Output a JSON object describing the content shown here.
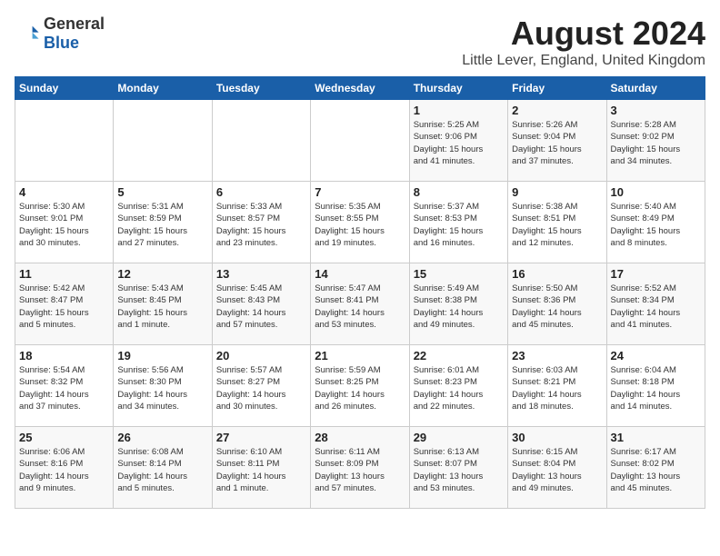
{
  "header": {
    "logo_general": "General",
    "logo_blue": "Blue",
    "month_year": "August 2024",
    "location": "Little Lever, England, United Kingdom"
  },
  "days_of_week": [
    "Sunday",
    "Monday",
    "Tuesday",
    "Wednesday",
    "Thursday",
    "Friday",
    "Saturday"
  ],
  "weeks": [
    [
      {
        "day": "",
        "detail": ""
      },
      {
        "day": "",
        "detail": ""
      },
      {
        "day": "",
        "detail": ""
      },
      {
        "day": "",
        "detail": ""
      },
      {
        "day": "1",
        "detail": "Sunrise: 5:25 AM\nSunset: 9:06 PM\nDaylight: 15 hours\nand 41 minutes."
      },
      {
        "day": "2",
        "detail": "Sunrise: 5:26 AM\nSunset: 9:04 PM\nDaylight: 15 hours\nand 37 minutes."
      },
      {
        "day": "3",
        "detail": "Sunrise: 5:28 AM\nSunset: 9:02 PM\nDaylight: 15 hours\nand 34 minutes."
      }
    ],
    [
      {
        "day": "4",
        "detail": "Sunrise: 5:30 AM\nSunset: 9:01 PM\nDaylight: 15 hours\nand 30 minutes."
      },
      {
        "day": "5",
        "detail": "Sunrise: 5:31 AM\nSunset: 8:59 PM\nDaylight: 15 hours\nand 27 minutes."
      },
      {
        "day": "6",
        "detail": "Sunrise: 5:33 AM\nSunset: 8:57 PM\nDaylight: 15 hours\nand 23 minutes."
      },
      {
        "day": "7",
        "detail": "Sunrise: 5:35 AM\nSunset: 8:55 PM\nDaylight: 15 hours\nand 19 minutes."
      },
      {
        "day": "8",
        "detail": "Sunrise: 5:37 AM\nSunset: 8:53 PM\nDaylight: 15 hours\nand 16 minutes."
      },
      {
        "day": "9",
        "detail": "Sunrise: 5:38 AM\nSunset: 8:51 PM\nDaylight: 15 hours\nand 12 minutes."
      },
      {
        "day": "10",
        "detail": "Sunrise: 5:40 AM\nSunset: 8:49 PM\nDaylight: 15 hours\nand 8 minutes."
      }
    ],
    [
      {
        "day": "11",
        "detail": "Sunrise: 5:42 AM\nSunset: 8:47 PM\nDaylight: 15 hours\nand 5 minutes."
      },
      {
        "day": "12",
        "detail": "Sunrise: 5:43 AM\nSunset: 8:45 PM\nDaylight: 15 hours\nand 1 minute."
      },
      {
        "day": "13",
        "detail": "Sunrise: 5:45 AM\nSunset: 8:43 PM\nDaylight: 14 hours\nand 57 minutes."
      },
      {
        "day": "14",
        "detail": "Sunrise: 5:47 AM\nSunset: 8:41 PM\nDaylight: 14 hours\nand 53 minutes."
      },
      {
        "day": "15",
        "detail": "Sunrise: 5:49 AM\nSunset: 8:38 PM\nDaylight: 14 hours\nand 49 minutes."
      },
      {
        "day": "16",
        "detail": "Sunrise: 5:50 AM\nSunset: 8:36 PM\nDaylight: 14 hours\nand 45 minutes."
      },
      {
        "day": "17",
        "detail": "Sunrise: 5:52 AM\nSunset: 8:34 PM\nDaylight: 14 hours\nand 41 minutes."
      }
    ],
    [
      {
        "day": "18",
        "detail": "Sunrise: 5:54 AM\nSunset: 8:32 PM\nDaylight: 14 hours\nand 37 minutes."
      },
      {
        "day": "19",
        "detail": "Sunrise: 5:56 AM\nSunset: 8:30 PM\nDaylight: 14 hours\nand 34 minutes."
      },
      {
        "day": "20",
        "detail": "Sunrise: 5:57 AM\nSunset: 8:27 PM\nDaylight: 14 hours\nand 30 minutes."
      },
      {
        "day": "21",
        "detail": "Sunrise: 5:59 AM\nSunset: 8:25 PM\nDaylight: 14 hours\nand 26 minutes."
      },
      {
        "day": "22",
        "detail": "Sunrise: 6:01 AM\nSunset: 8:23 PM\nDaylight: 14 hours\nand 22 minutes."
      },
      {
        "day": "23",
        "detail": "Sunrise: 6:03 AM\nSunset: 8:21 PM\nDaylight: 14 hours\nand 18 minutes."
      },
      {
        "day": "24",
        "detail": "Sunrise: 6:04 AM\nSunset: 8:18 PM\nDaylight: 14 hours\nand 14 minutes."
      }
    ],
    [
      {
        "day": "25",
        "detail": "Sunrise: 6:06 AM\nSunset: 8:16 PM\nDaylight: 14 hours\nand 9 minutes."
      },
      {
        "day": "26",
        "detail": "Sunrise: 6:08 AM\nSunset: 8:14 PM\nDaylight: 14 hours\nand 5 minutes."
      },
      {
        "day": "27",
        "detail": "Sunrise: 6:10 AM\nSunset: 8:11 PM\nDaylight: 14 hours\nand 1 minute."
      },
      {
        "day": "28",
        "detail": "Sunrise: 6:11 AM\nSunset: 8:09 PM\nDaylight: 13 hours\nand 57 minutes."
      },
      {
        "day": "29",
        "detail": "Sunrise: 6:13 AM\nSunset: 8:07 PM\nDaylight: 13 hours\nand 53 minutes."
      },
      {
        "day": "30",
        "detail": "Sunrise: 6:15 AM\nSunset: 8:04 PM\nDaylight: 13 hours\nand 49 minutes."
      },
      {
        "day": "31",
        "detail": "Sunrise: 6:17 AM\nSunset: 8:02 PM\nDaylight: 13 hours\nand 45 minutes."
      }
    ]
  ]
}
